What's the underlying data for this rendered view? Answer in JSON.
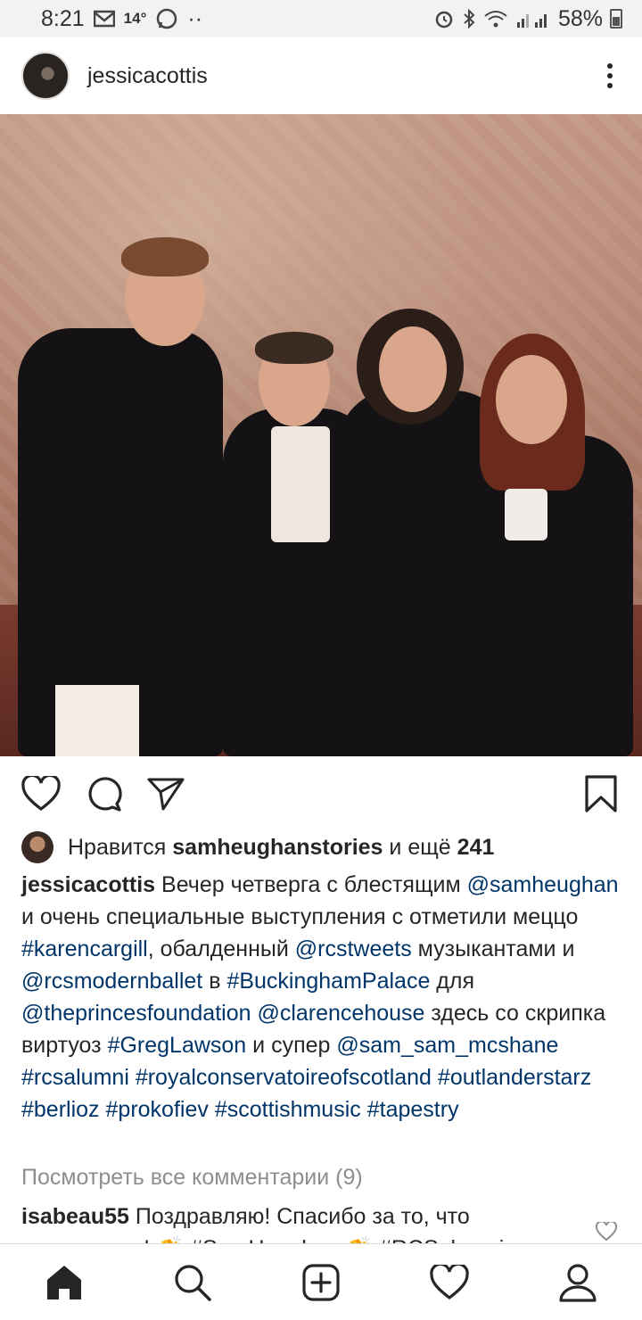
{
  "status_bar": {
    "time": "8:21",
    "temperature": "14°",
    "dots": "··",
    "battery": "58%",
    "icons": [
      "gmail-icon",
      "whatsapp-icon",
      "alarm-icon",
      "bluetooth-icon",
      "wifi-icon",
      "signal-icon",
      "battery-icon"
    ]
  },
  "post": {
    "username": "jessicacottis",
    "likes": {
      "prefix": "Нравится",
      "user": "samheughanstories",
      "middle": "и ещё",
      "count": "241"
    },
    "caption": {
      "user": "jessicacottis",
      "parts": [
        " Вечер четверга с блестящим ",
        "@samheughan",
        " и очень специальные выступления с отметили меццо ",
        "#karencargill",
        ", обалденный ",
        "@rcstweets",
        " музыкантами и ",
        "@rcsmodernballet",
        " в ",
        "#BuckinghamPalace",
        " для ",
        "@theprincesfoundation",
        " ",
        "@clarencehouse",
        " здесь со скрипка виртуоз ",
        "#GregLawson",
        " и супер ",
        "@sam_sam_mcshane",
        " ",
        "#rcsalumni",
        " ",
        "#royalconservatoireofscotland",
        " ",
        "#outlanderstarz",
        " ",
        "#berlioz",
        " ",
        "#prokofiev",
        " ",
        "#scottishmusic",
        " ",
        "#tapestry"
      ]
    },
    "view_comments": "Посмотреть все комментарии (9)",
    "comment": {
      "user": "isabeau55",
      "text": " Поздравляю! Спасибо за то, что поделились! 👏 #SamHeughan 👏 #RCSalumni"
    }
  },
  "nav": [
    "home-icon",
    "search-icon",
    "add-post-icon",
    "activity-heart-icon",
    "profile-icon"
  ]
}
